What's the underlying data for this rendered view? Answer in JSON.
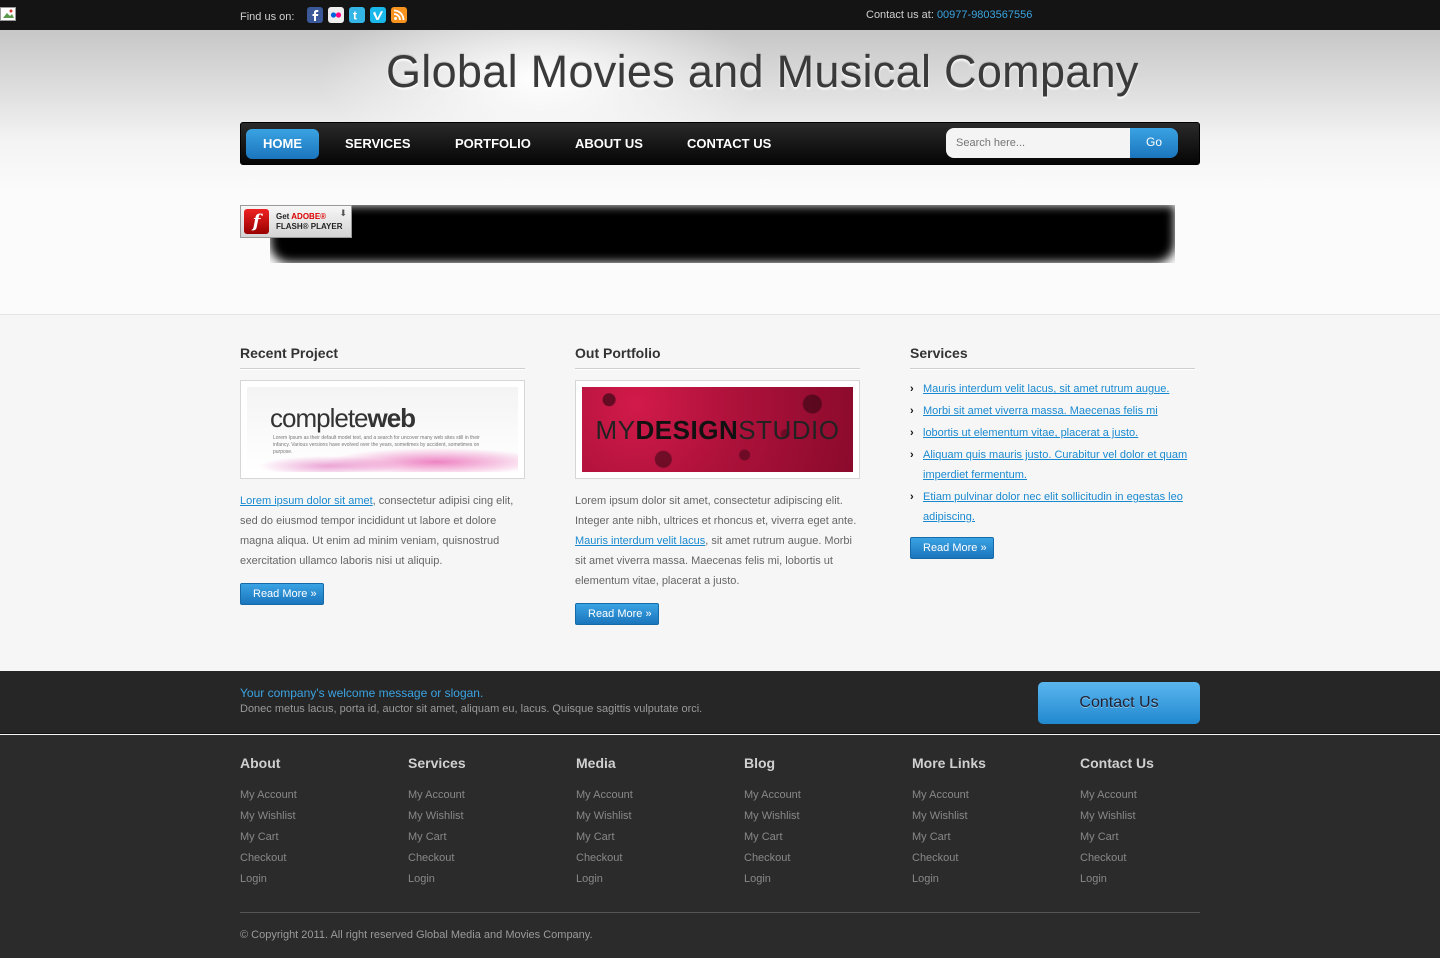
{
  "topbar": {
    "find_us": "Find us on:",
    "social_icons": [
      "facebook-icon",
      "flickr-icon",
      "twitter-icon",
      "vimeo-icon",
      "rss-icon"
    ],
    "contact_label": "Contact us at:",
    "phone": "00977-9803567556"
  },
  "header": {
    "brand": "Global Movies and Musical Company"
  },
  "nav": {
    "items": [
      {
        "label": "HOME",
        "active": true
      },
      {
        "label": "SERVICES"
      },
      {
        "label": "PORTFOLIO"
      },
      {
        "label": "ABOUT US"
      },
      {
        "label": "CONTACT US"
      }
    ],
    "search_placeholder": "Search here...",
    "search_go": "Go"
  },
  "flash": {
    "get": "Get",
    "adobe": "ADOBE®",
    "player": "FLASH® PLAYER"
  },
  "recent": {
    "title": "Recent Project",
    "thumb_brand_light": "complete",
    "thumb_brand_bold": "web",
    "thumb_caption": "Lorem Ipsum as their default model text, and a search for uncover many web sites still in their infancy. Various versions have evolved over the years, sometimes by accident, sometimes on purpose.",
    "link": "Lorem ipsum dolor sit amet",
    "text": ", consectetur adipisi cing elit, sed do eiusmod tempor incididunt ut labore et dolore magna aliqua. Ut enim ad minim veniam, quisnostrud exercitation ullamco laboris nisi ut aliquip.",
    "read_more": "Read More »"
  },
  "portfolio": {
    "title": "Out Portfolio",
    "thumb_my": "MY",
    "thumb_design": "DESIGN",
    "thumb_studio": "STUDIO",
    "text1": "Lorem ipsum dolor sit amet, consectetur adipiscing elit. Integer ante nibh, ultrices et rhoncus et, viverra eget ante.",
    "link": "Mauris interdum velit lacus",
    "text2": ", sit amet rutrum augue. Morbi sit amet viverra massa. Maecenas felis mi, lobortis ut elementum vitae, placerat a justo.",
    "read_more": "Read More »"
  },
  "services": {
    "title": "Services",
    "items": [
      "Mauris interdum velit lacus, sit amet rutrum augue.",
      "Morbi sit amet viverra massa. Maecenas felis mi",
      "lobortis ut elementum vitae, placerat a justo.",
      "Aliquam quis mauris justo. Curabitur vel dolor et quam imperdiet fermentum.",
      "Etiam pulvinar dolor nec elit sollicitudin in egestas leo adipiscing."
    ],
    "read_more": "Read More »"
  },
  "welcome": {
    "title": "Your company's welcome message or slogan.",
    "sub": "Donec metus lacus, porta id, auctor sit amet, aliquam eu, lacus. Quisque sagittis vulputate orci.",
    "contact_button": "Contact Us"
  },
  "footer": {
    "columns": [
      {
        "title": "About",
        "links": [
          "My Account",
          "My Wishlist",
          "My Cart",
          "Checkout",
          "Login"
        ]
      },
      {
        "title": "Services",
        "links": [
          "My Account",
          "My Wishlist",
          "My Cart",
          "Checkout",
          "Login"
        ]
      },
      {
        "title": "Media",
        "links": [
          "My Account",
          "My Wishlist",
          "My Cart",
          "Checkout",
          "Login"
        ]
      },
      {
        "title": "Blog",
        "links": [
          "My Account",
          "My Wishlist",
          "My Cart",
          "Checkout",
          "Login"
        ]
      },
      {
        "title": "More Links",
        "links": [
          "My Account",
          "My Wishlist",
          "My Cart",
          "Checkout",
          "Login"
        ]
      },
      {
        "title": "Contact Us",
        "links": [
          "My Account",
          "My Wishlist",
          "My Cart",
          "Checkout",
          "Login"
        ]
      }
    ],
    "copyright": "© Copyright 2011. All right reserved Global Media and Movies Company."
  },
  "colors": {
    "accent": "#1a8ad0",
    "topbar": "#141414",
    "footer": "#2b2b2b"
  }
}
